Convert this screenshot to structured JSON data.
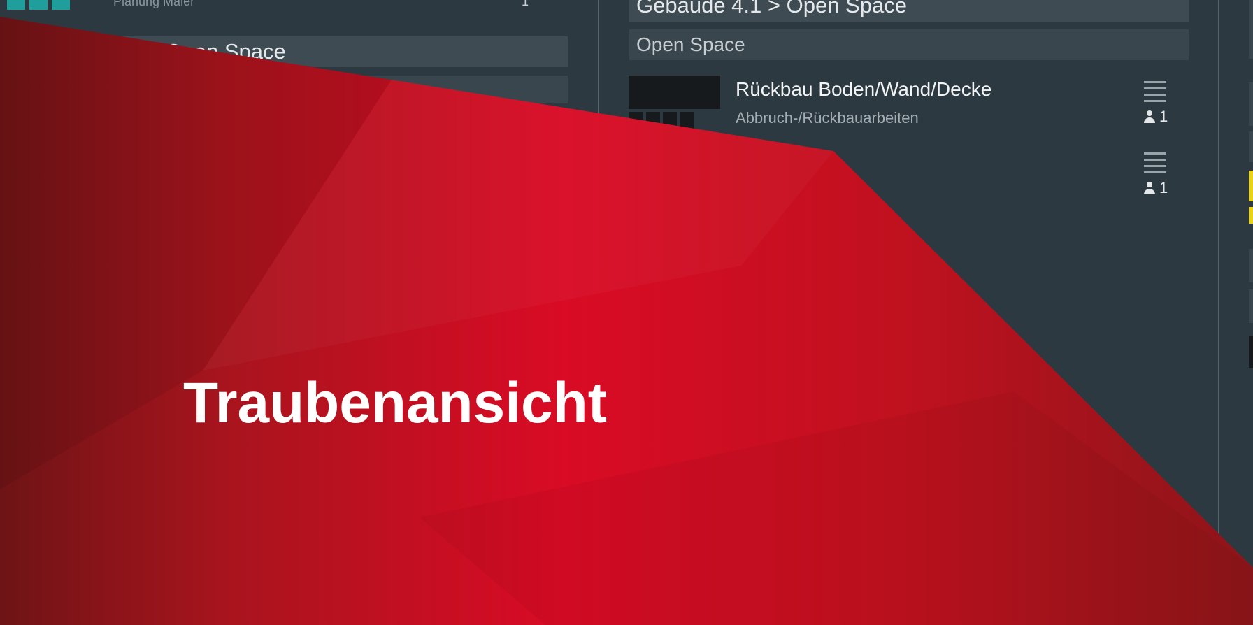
{
  "left_panel": {
    "meta_text": "Planung Maler",
    "count_text": "1",
    "breadcrumb": "4.1 > Open Space"
  },
  "middle_panel": {
    "breadcrumb": "Gebäude 4.1 > Open Space",
    "section": "Open Space",
    "tasks": [
      {
        "title": "Rückbau Boden/Wand/Decke",
        "subtitle": "Abbruch-/Rückbauarbeiten",
        "people": "1"
      },
      {
        "title": "",
        "subtitle": "",
        "people": "1"
      }
    ]
  },
  "overlay": {
    "title": "Traubenansicht"
  },
  "colors": {
    "background": "#2d3940",
    "accent_red": "#d50c24",
    "accent_teal": "#1f9e9b",
    "accent_yellow": "#e8d21a"
  },
  "icons": [
    "menu-lines-icon",
    "person-icon"
  ]
}
